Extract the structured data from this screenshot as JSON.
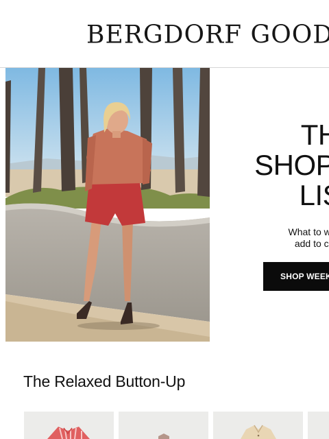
{
  "brand": {
    "logo_text": "BERGDORF GOODMAN"
  },
  "hero": {
    "title_lines": [
      "THE",
      "SHOPPING",
      "LIST"
    ],
    "subtitle_lines": [
      "What to wear, cover and",
      "add to cart this week."
    ],
    "cta_label": "SHOP WEEKLY PICKS"
  },
  "section": {
    "title": "The Relaxed Button-Up"
  },
  "colors": {
    "cta_background": "#0b0b0b",
    "product_tile_background": "#ececea",
    "header_divider": "#d6d6d6"
  }
}
